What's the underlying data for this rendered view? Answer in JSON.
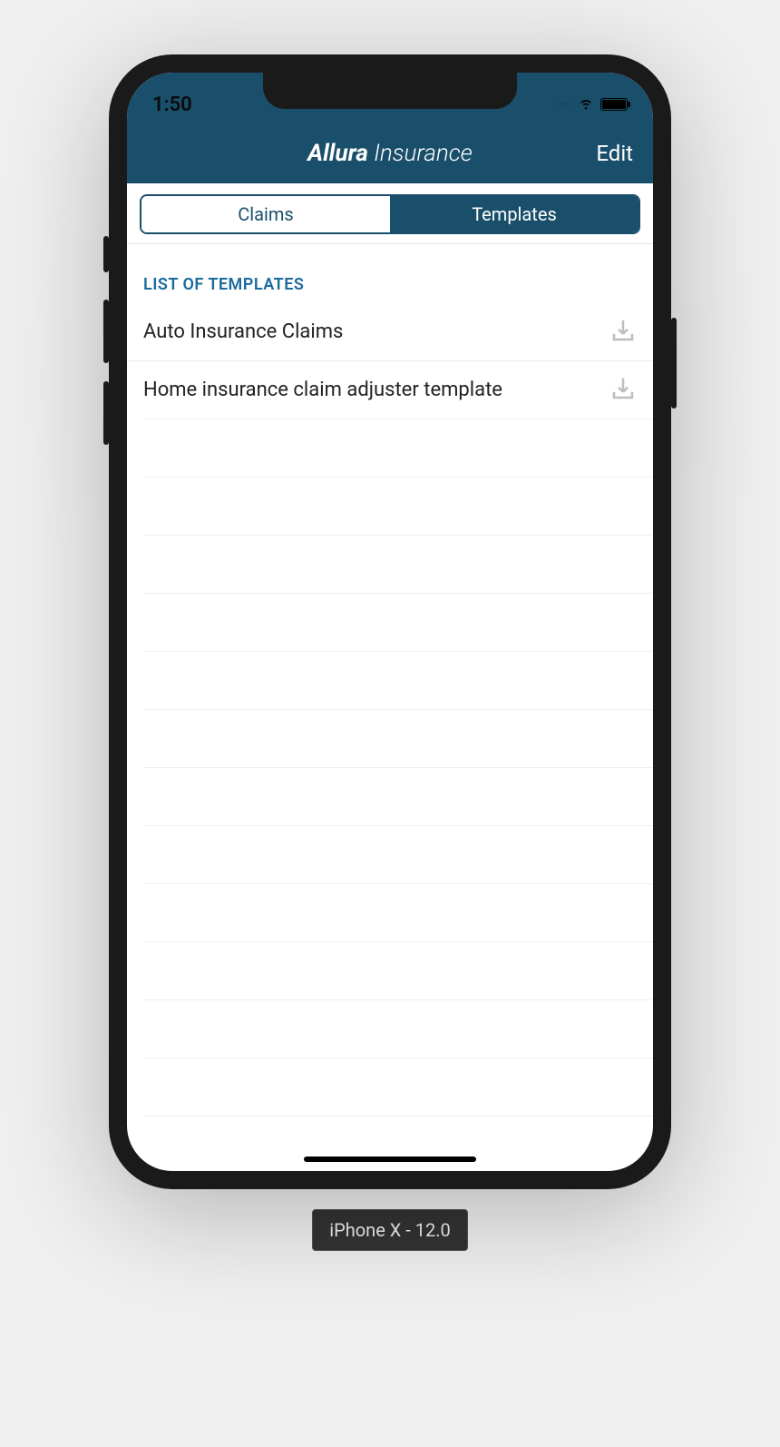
{
  "status": {
    "time": "1:50"
  },
  "header": {
    "brand": "Allura",
    "sub": " Insurance",
    "edit": "Edit"
  },
  "tabs": {
    "left": "Claims",
    "right": "Templates"
  },
  "section_title": "LIST OF TEMPLATES",
  "templates": [
    {
      "label": "Auto Insurance Claims"
    },
    {
      "label": "Home insurance claim adjuster template"
    }
  ],
  "device_label": "iPhone X - 12.0"
}
